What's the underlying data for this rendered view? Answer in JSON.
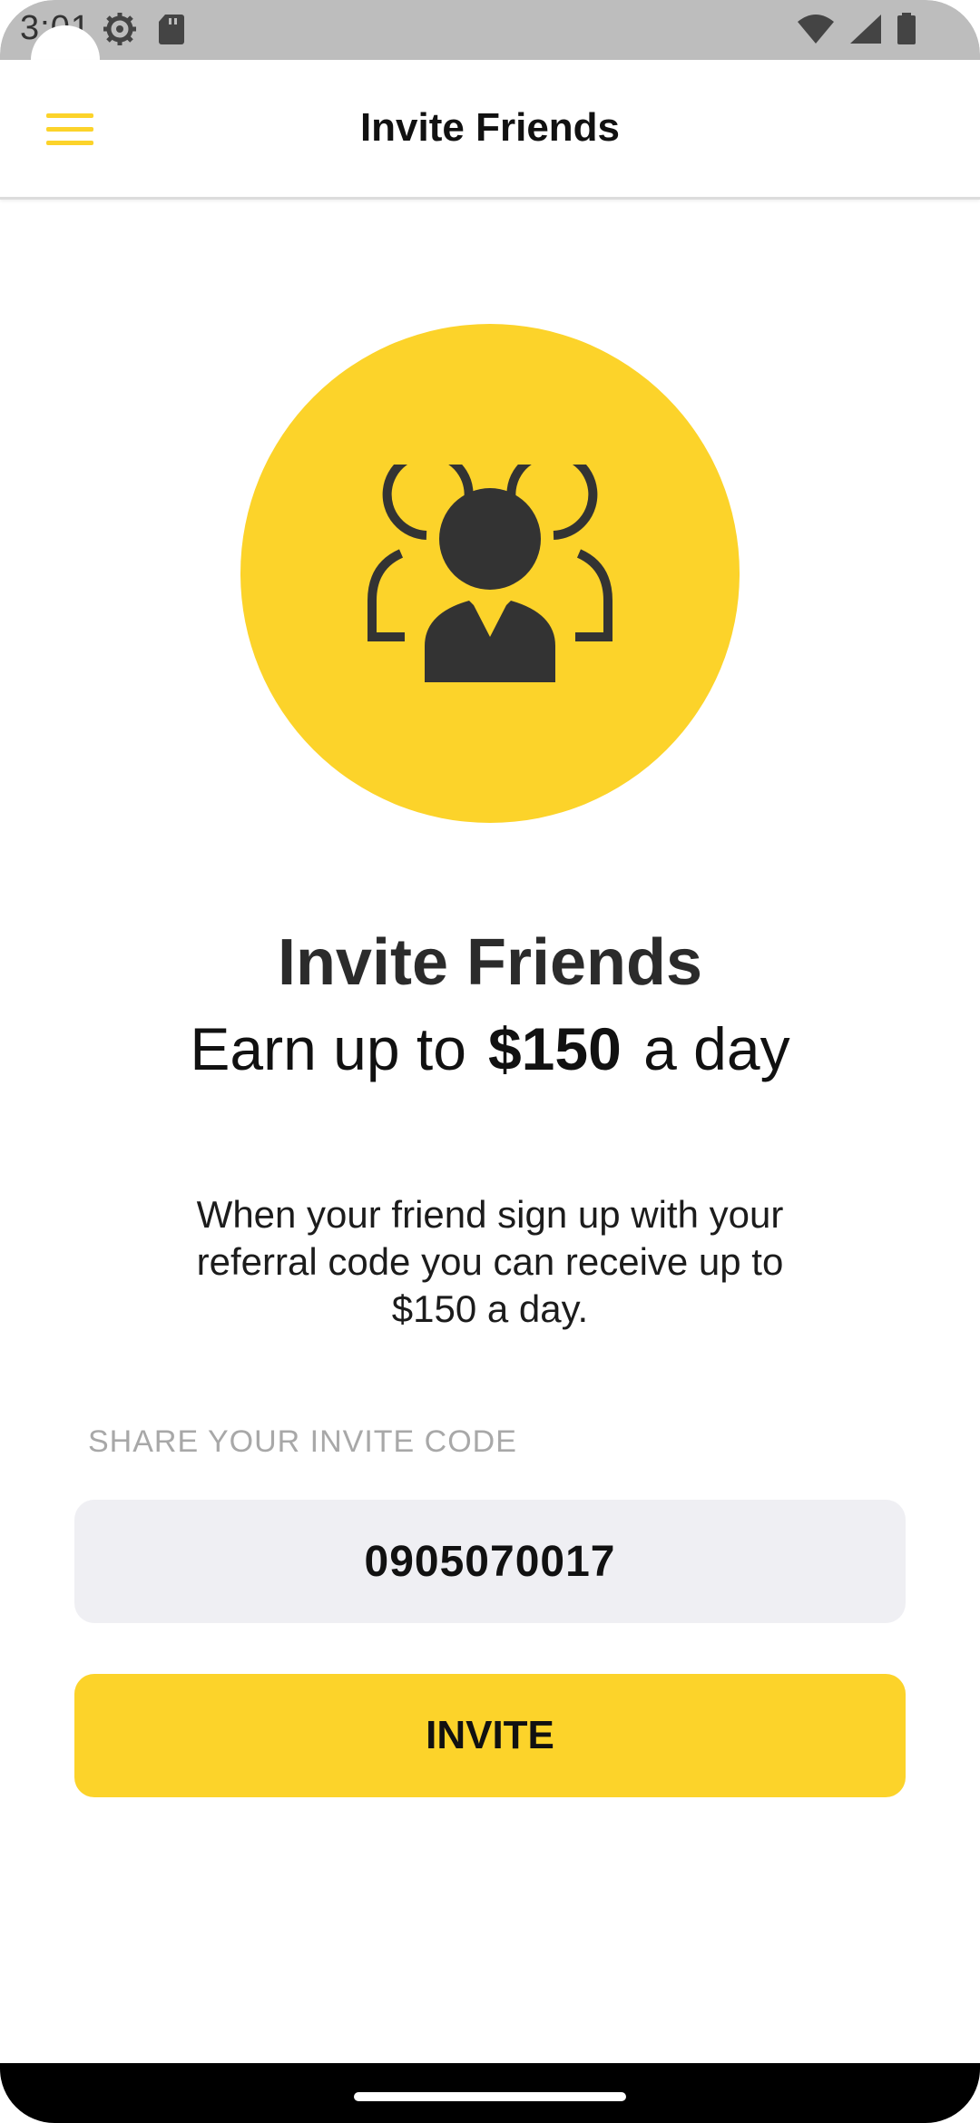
{
  "status_bar": {
    "time": "3:01",
    "icons": [
      "settings-gear-icon",
      "sd-card-icon",
      "wifi-icon",
      "cell-signal-icon",
      "battery-icon"
    ]
  },
  "app_bar": {
    "title": "Invite Friends",
    "menu_icon": "hamburger-menu-icon"
  },
  "hero": {
    "icon": "group-of-people-icon"
  },
  "content": {
    "headline": "Invite Friends",
    "sub_prefix": "Earn up to",
    "sub_amount": "$150",
    "sub_suffix": "a day",
    "description": "When your friend sign up with your referral code you can receive up to $150 a day.",
    "share_label": "SHARE YOUR INVITE CODE",
    "invite_code": "0905070017",
    "invite_button": "INVITE"
  },
  "colors": {
    "accent": "#FCD32A",
    "icon_dark": "#333333",
    "code_box_bg": "#EFEFF3"
  }
}
